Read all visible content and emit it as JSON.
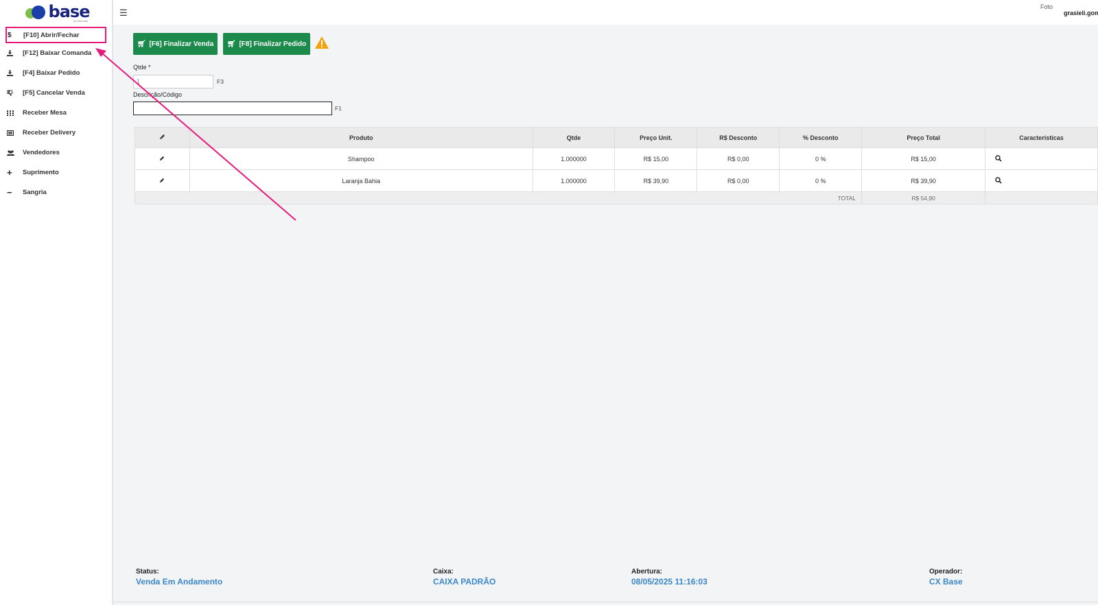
{
  "brand": {
    "name": "base",
    "sub": "by Alterdata"
  },
  "sidebar": {
    "items": [
      {
        "icon": "$",
        "label": "[F10] Abrir/Fechar"
      },
      {
        "icon": "download",
        "label": "[F12] Baixar Comanda"
      },
      {
        "icon": "download",
        "label": "[F4] Baixar Pedido"
      },
      {
        "icon": "thumbs-down",
        "label": "[F5] Cancelar Venda"
      },
      {
        "icon": "grid",
        "label": "Receber Mesa"
      },
      {
        "icon": "list",
        "label": "Receber Delivery"
      },
      {
        "icon": "users",
        "label": "Vendedores"
      },
      {
        "icon": "plus",
        "label": "Suprimento"
      },
      {
        "icon": "minus",
        "label": "Sangria"
      }
    ]
  },
  "topbar": {
    "photo_alt": "Foto",
    "user": "grasieli.gomes"
  },
  "actions": {
    "finalizar_venda": "[F6] Finalizar Venda",
    "finalizar_pedido": "[F8] Finalizar Pedido"
  },
  "form": {
    "qtde_label": "Qtde *",
    "qtde_value": "1",
    "qtde_key": "F3",
    "desc_label": "Descrição/Código",
    "desc_value": "",
    "desc_key": "F1"
  },
  "table": {
    "headers": [
      "Produto",
      "Qtde",
      "Preço Unit.",
      "R$ Desconto",
      "% Desconto",
      "Preço Total",
      "Características"
    ],
    "rows": [
      {
        "produto": "Shampoo",
        "qtde": "1.000000",
        "preco_unit": "R$ 15,00",
        "desc_rs": "R$ 0,00",
        "desc_pct": "0 %",
        "preco_total": "R$ 15,00"
      },
      {
        "produto": "Laranja Bahia",
        "qtde": "1.000000",
        "preco_unit": "R$ 39,90",
        "desc_rs": "R$ 0,00",
        "desc_pct": "0 %",
        "preco_total": "R$ 39,90"
      }
    ],
    "total_label": "TOTAL",
    "total_value": "R$ 54,90"
  },
  "status_bar": {
    "status_label": "Status:",
    "status_value": "Venda Em Andamento",
    "caixa_label": "Caixa:",
    "caixa_value": "CAIXA PADRÃO",
    "abertura_label": "Abertura:",
    "abertura_value": "08/05/2025 11:16:03",
    "operador_label": "Operador:",
    "operador_value": "CX Base"
  },
  "colors": {
    "green": "#1b8a4a",
    "highlight": "#e5197c",
    "status_value": "#3a86c8",
    "warning": "#f0a30a"
  }
}
